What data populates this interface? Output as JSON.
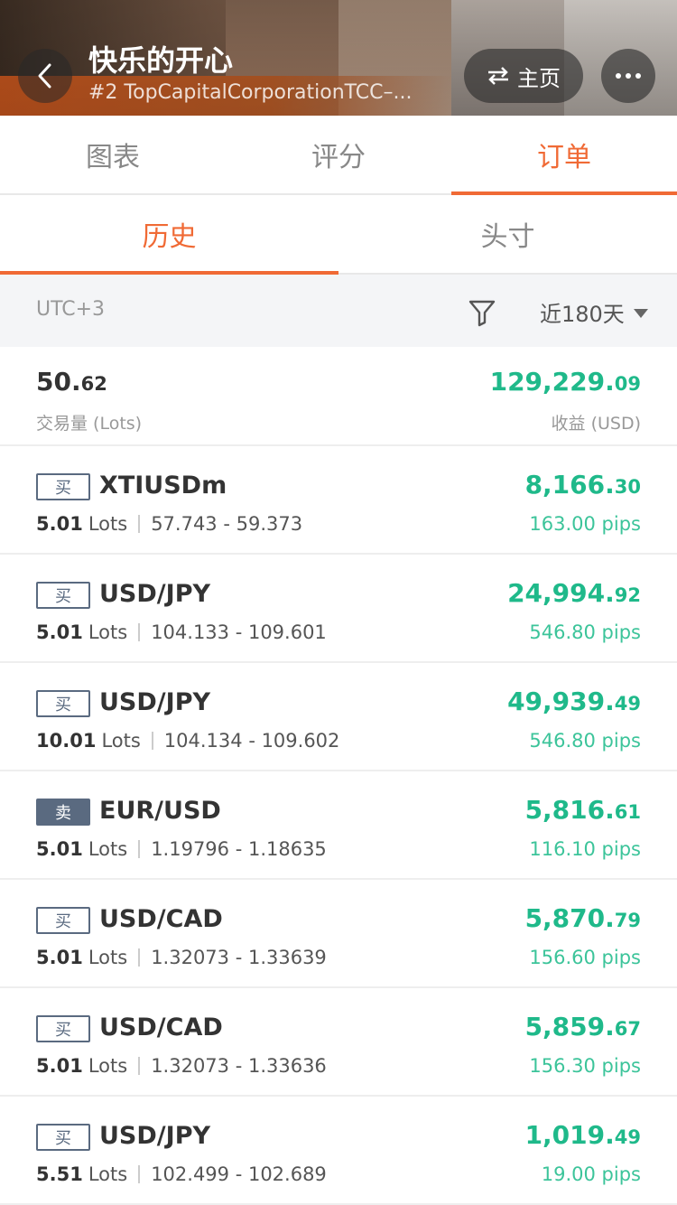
{
  "header": {
    "title": "快乐的开心",
    "subtitle": "#2 TopCapitalCorporationTCC–...",
    "home_label": "主页",
    "back_icon": "chevron-left-icon",
    "swap_icon": "swap-arrows-icon",
    "more_icon": "more-dots-icon"
  },
  "main_tabs": [
    {
      "label": "图表",
      "active": false
    },
    {
      "label": "评分",
      "active": false
    },
    {
      "label": "订单",
      "active": true
    }
  ],
  "sub_tabs": [
    {
      "label": "历史",
      "active": true
    },
    {
      "label": "头寸",
      "active": false
    }
  ],
  "filter": {
    "timezone": "UTC+3",
    "period": "近180天",
    "filter_icon": "funnel-icon"
  },
  "summary": {
    "volume_main": "50.",
    "volume_dec": "62",
    "volume_label": "交易量 (Lots)",
    "profit_main": "129,229.",
    "profit_dec": "09",
    "profit_label": "收益 (USD)"
  },
  "orders": [
    {
      "side": "买",
      "symbol": "XTIUSDm",
      "lots": "5.01",
      "lots_unit": "Lots",
      "range": "57.743 - 59.373",
      "profit_main": "8,166.",
      "profit_dec": "30",
      "pips": "163.00 pips"
    },
    {
      "side": "买",
      "symbol": "USD/JPY",
      "lots": "5.01",
      "lots_unit": "Lots",
      "range": "104.133 - 109.601",
      "profit_main": "24,994.",
      "profit_dec": "92",
      "pips": "546.80 pips"
    },
    {
      "side": "买",
      "symbol": "USD/JPY",
      "lots": "10.01",
      "lots_unit": "Lots",
      "range": "104.134 - 109.602",
      "profit_main": "49,939.",
      "profit_dec": "49",
      "pips": "546.80 pips"
    },
    {
      "side": "卖",
      "symbol": "EUR/USD",
      "lots": "5.01",
      "lots_unit": "Lots",
      "range": "1.19796 - 1.18635",
      "profit_main": "5,816.",
      "profit_dec": "61",
      "pips": "116.10 pips"
    },
    {
      "side": "买",
      "symbol": "USD/CAD",
      "lots": "5.01",
      "lots_unit": "Lots",
      "range": "1.32073 - 1.33639",
      "profit_main": "5,870.",
      "profit_dec": "79",
      "pips": "156.60 pips"
    },
    {
      "side": "买",
      "symbol": "USD/CAD",
      "lots": "5.01",
      "lots_unit": "Lots",
      "range": "1.32073 - 1.33636",
      "profit_main": "5,859.",
      "profit_dec": "67",
      "pips": "156.30 pips"
    },
    {
      "side": "买",
      "symbol": "USD/JPY",
      "lots": "5.51",
      "lots_unit": "Lots",
      "range": "102.499 - 102.689",
      "profit_main": "1,019.",
      "profit_dec": "49",
      "pips": "19.00 pips"
    }
  ],
  "colors": {
    "accent": "#f06a35",
    "profit": "#1fb98a",
    "badge": "#5a6a80"
  }
}
